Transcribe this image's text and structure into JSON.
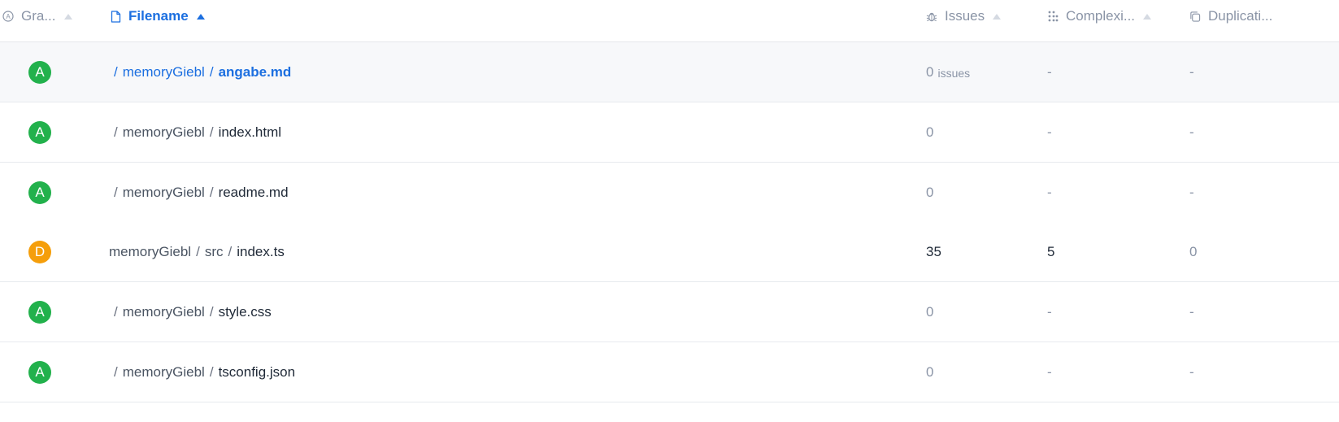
{
  "header": {
    "grade_label": "Gra...",
    "filename_label": "Filename",
    "issues_label": "Issues",
    "complexity_label": "Complexi...",
    "duplication_label": "Duplicati..."
  },
  "colors": {
    "accent": "#1c6fe0",
    "grade_a": "#22b14c",
    "grade_d": "#f59e0b",
    "muted_text": "#8a94a6"
  },
  "rows": [
    {
      "grade": "A",
      "path": [
        "",
        "memoryGiebl",
        "angabe.md"
      ],
      "issues": "0",
      "issues_unit": "issues",
      "complexity": "-",
      "duplication": "-"
    },
    {
      "grade": "A",
      "path": [
        "",
        "memoryGiebl",
        "index.html"
      ],
      "issues": "0",
      "complexity": "-",
      "duplication": "-"
    },
    {
      "grade": "A",
      "path": [
        "",
        "memoryGiebl",
        "readme.md"
      ],
      "issues": "0",
      "complexity": "-",
      "duplication": "-"
    },
    {
      "grade": "D",
      "path": [
        "memoryGiebl",
        "src",
        "index.ts"
      ],
      "issues": "35",
      "complexity": "5",
      "duplication": "0"
    },
    {
      "grade": "A",
      "path": [
        "",
        "memoryGiebl",
        "style.css"
      ],
      "issues": "0",
      "complexity": "-",
      "duplication": "-"
    },
    {
      "grade": "A",
      "path": [
        "",
        "memoryGiebl",
        "tsconfig.json"
      ],
      "issues": "0",
      "complexity": "-",
      "duplication": "-"
    }
  ]
}
